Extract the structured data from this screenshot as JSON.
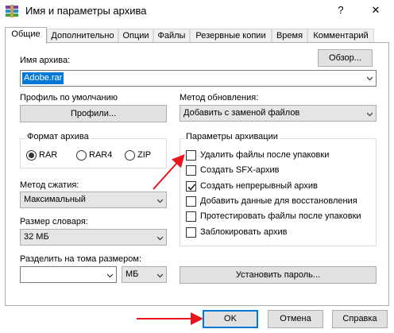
{
  "window": {
    "title": "Имя и параметры архива",
    "help_label": "?",
    "close_label": "✕"
  },
  "tabs": [
    {
      "label": "Общие",
      "active": true
    },
    {
      "label": "Дополнительно",
      "active": false
    },
    {
      "label": "Опции",
      "active": false
    },
    {
      "label": "Файлы",
      "active": false
    },
    {
      "label": "Резервные копии",
      "active": false
    },
    {
      "label": "Время",
      "active": false
    },
    {
      "label": "Комментарий",
      "active": false
    }
  ],
  "archive_name": {
    "label": "Имя архива:",
    "value": "Adobe.rar",
    "browse_label": "Обзор..."
  },
  "profile": {
    "label": "Профиль по умолчанию",
    "button_label": "Профили..."
  },
  "update_method": {
    "label": "Метод обновления:",
    "value": "Добавить с заменой файлов"
  },
  "format": {
    "legend": "Формат архива",
    "options": [
      {
        "label": "RAR",
        "selected": true
      },
      {
        "label": "RAR4",
        "selected": false
      },
      {
        "label": "ZIP",
        "selected": false
      }
    ]
  },
  "compression": {
    "label": "Метод сжатия:",
    "value": "Максимальный"
  },
  "dictionary": {
    "label": "Размер словаря:",
    "value": "32 МБ"
  },
  "split": {
    "label": "Разделить на тома размером:",
    "value": "",
    "unit": "МБ"
  },
  "set_password_label": "Установить пароль...",
  "archive_options": {
    "legend": "Параметры архивации",
    "items": [
      {
        "label": "Удалить файлы после упаковки",
        "checked": false
      },
      {
        "label": "Создать SFX-архив",
        "checked": false
      },
      {
        "label": "Создать непрерывный архив",
        "checked": true
      },
      {
        "label": "Добавить данные для восстановления",
        "checked": false
      },
      {
        "label": "Протестировать файлы после упаковки",
        "checked": false
      },
      {
        "label": "Заблокировать архив",
        "checked": false
      }
    ]
  },
  "footer": {
    "ok_label": "OK",
    "cancel_label": "Отмена",
    "help_label": "Справка"
  },
  "colors": {
    "accent": "#0078d7",
    "annotation_arrow": "#e8141e"
  }
}
